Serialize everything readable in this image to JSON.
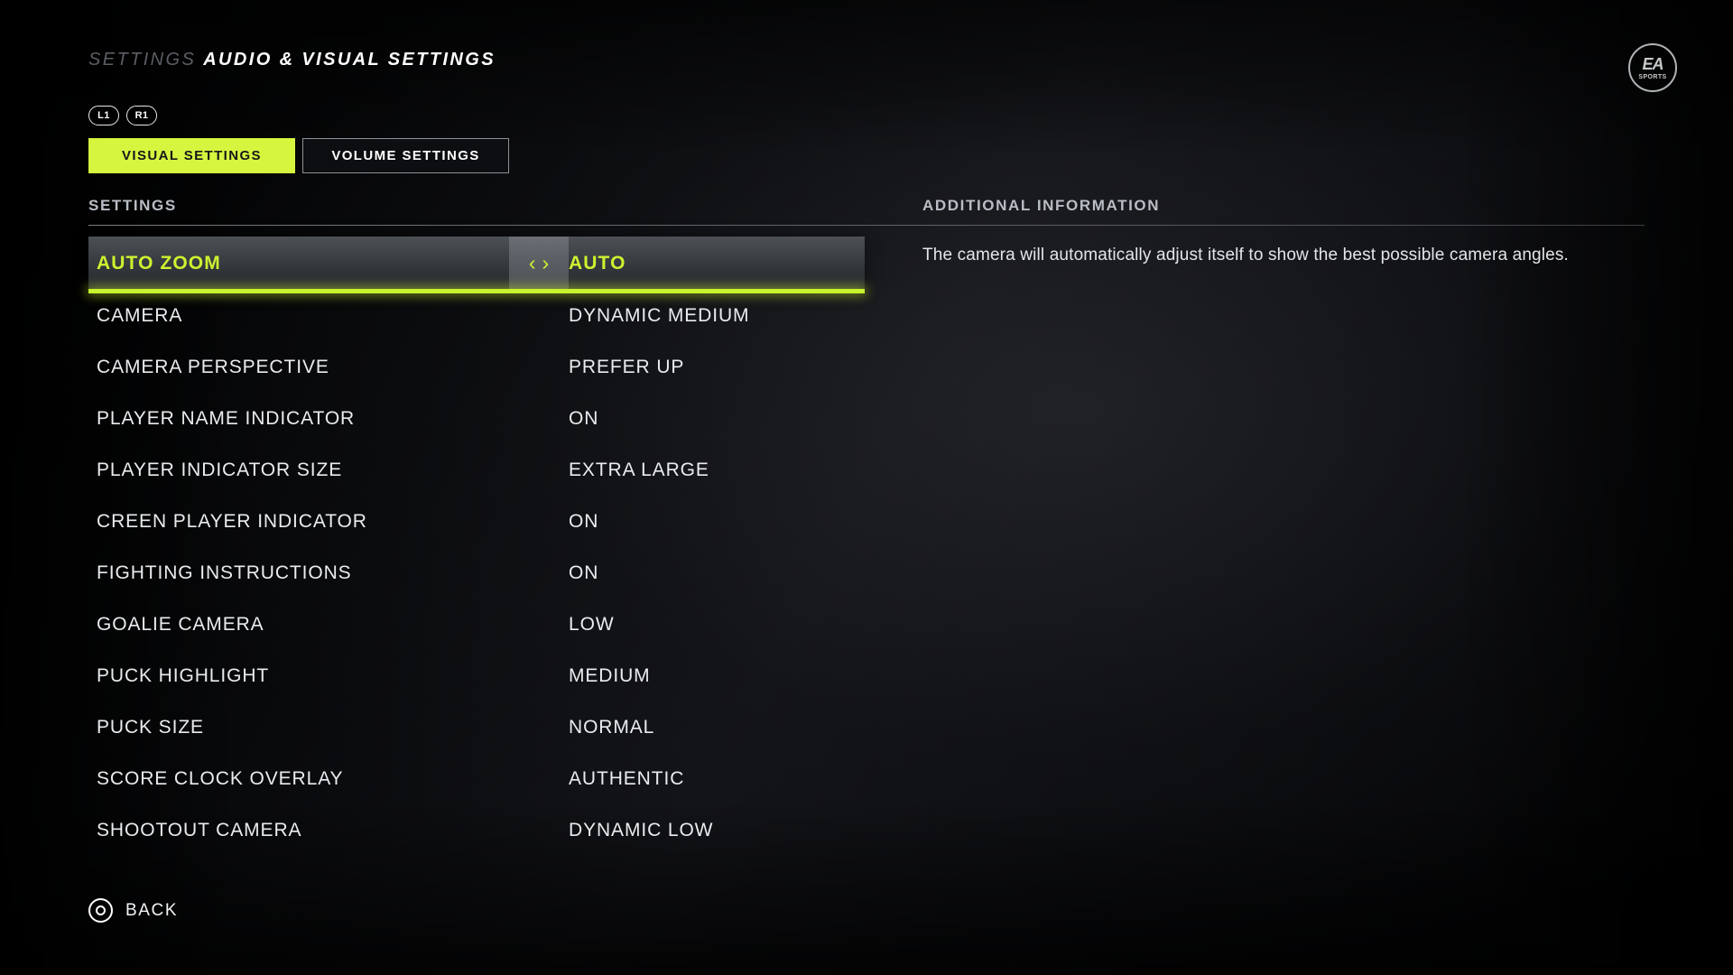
{
  "header": {
    "breadcrumb_parent": "SETTINGS",
    "breadcrumb_current": "AUDIO & VISUAL SETTINGS",
    "logo_mark": "EA",
    "logo_sub": "SPORTS"
  },
  "shoulder_buttons": [
    {
      "label": "L1",
      "icon": "shoulder-button-left-icon"
    },
    {
      "label": "R1",
      "icon": "shoulder-button-right-icon"
    }
  ],
  "tabs": [
    {
      "label": "VISUAL SETTINGS",
      "active": true
    },
    {
      "label": "VOLUME SETTINGS",
      "active": false
    }
  ],
  "columns": {
    "settings_header": "SETTINGS",
    "info_header": "ADDITIONAL INFORMATION"
  },
  "arrows": {
    "left_icon": "chevron-left-icon",
    "right_icon": "chevron-right-icon",
    "left_glyph": "‹",
    "right_glyph": "›"
  },
  "settings": [
    {
      "label": "AUTO ZOOM",
      "value": "AUTO",
      "selected": true
    },
    {
      "label": "CAMERA",
      "value": "DYNAMIC MEDIUM",
      "selected": false
    },
    {
      "label": "CAMERA PERSPECTIVE",
      "value": "PREFER UP",
      "selected": false
    },
    {
      "label": "PLAYER NAME INDICATOR",
      "value": "ON",
      "selected": false
    },
    {
      "label": "PLAYER INDICATOR SIZE",
      "value": "EXTRA LARGE",
      "selected": false
    },
    {
      "label": "CREEN PLAYER INDICATOR",
      "value": "ON",
      "selected": false
    },
    {
      "label": "FIGHTING INSTRUCTIONS",
      "value": "ON",
      "selected": false
    },
    {
      "label": "GOALIE CAMERA",
      "value": "LOW",
      "selected": false
    },
    {
      "label": "PUCK HIGHLIGHT",
      "value": "MEDIUM",
      "selected": false
    },
    {
      "label": "PUCK SIZE",
      "value": "NORMAL",
      "selected": false
    },
    {
      "label": "SCORE CLOCK OVERLAY",
      "value": "AUTHENTIC",
      "selected": false
    },
    {
      "label": "SHOOTOUT CAMERA",
      "value": "DYNAMIC LOW",
      "selected": false
    }
  ],
  "info": {
    "text": "The camera will automatically adjust itself to show the best possible camera angles."
  },
  "footer": {
    "back_icon": "circle-button-icon",
    "back_label": "BACK"
  },
  "colors": {
    "accent_lime": "#d6f53f",
    "selected_text": "#cdf230",
    "underline": "#c8f32e",
    "text_primary": "#e9ebee",
    "text_muted": "#b9bdc4",
    "background": "#000000"
  }
}
